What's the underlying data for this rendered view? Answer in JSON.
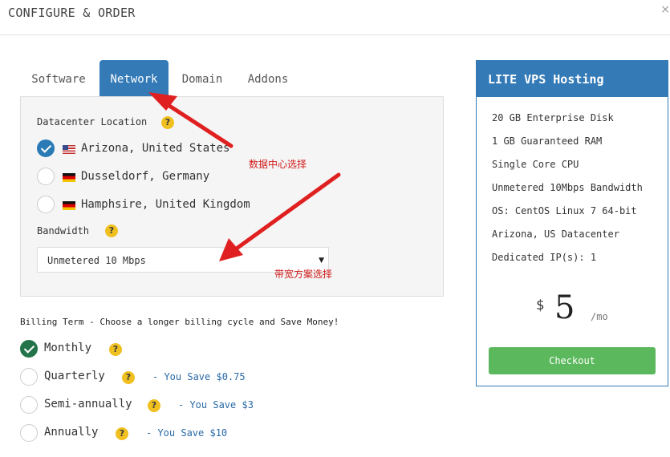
{
  "header": {
    "title": "CONFIGURE & ORDER",
    "close": "×"
  },
  "tabs": [
    {
      "label": "Software",
      "active": false
    },
    {
      "label": "Network",
      "active": true
    },
    {
      "label": "Domain",
      "active": false
    },
    {
      "label": "Addons",
      "active": false
    }
  ],
  "network": {
    "datacenter_label": "Datacenter Location",
    "help": "?",
    "locations": [
      {
        "label": "Arizona, United States",
        "flag": "us-flag-icon",
        "selected": true
      },
      {
        "label": "Dusseldorf, Germany",
        "flag": "de-flag-icon",
        "selected": false
      },
      {
        "label": "Hamphsire, United Kingdom",
        "flag": "de-flag-icon",
        "selected": false
      }
    ],
    "bandwidth_label": "Bandwidth",
    "bandwidth_value": "Unmetered 10 Mbps",
    "caret": "▼"
  },
  "annotations": {
    "datacenter": "数据中心选择",
    "bandwidth": "带宽方案选择",
    "color": "#e02020"
  },
  "billing": {
    "title": "Billing Term - Choose a longer billing cycle and Save Money!",
    "options": [
      {
        "label": "Monthly",
        "save": "",
        "selected": true
      },
      {
        "label": "Quarterly",
        "save": "- You Save $0.75",
        "selected": false
      },
      {
        "label": "Semi-annually",
        "save": "- You Save $3",
        "selected": false
      },
      {
        "label": "Annually",
        "save": "- You Save $10",
        "selected": false
      }
    ]
  },
  "summary": {
    "title": "LITE VPS Hosting",
    "features": [
      "20 GB Enterprise Disk",
      "1 GB Guaranteed RAM",
      "Single Core CPU",
      "Unmetered 10Mbps Bandwidth",
      "OS: CentOS Linux 7 64-bit",
      "Arizona, US Datacenter",
      "Dedicated IP(s): 1"
    ],
    "currency": "$",
    "price": "5",
    "period": "/mo",
    "checkout": "Checkout"
  },
  "colors": {
    "primary": "#337ab7",
    "success": "#5cb85c",
    "help": "#f0c020",
    "check_green": "#23744b"
  }
}
